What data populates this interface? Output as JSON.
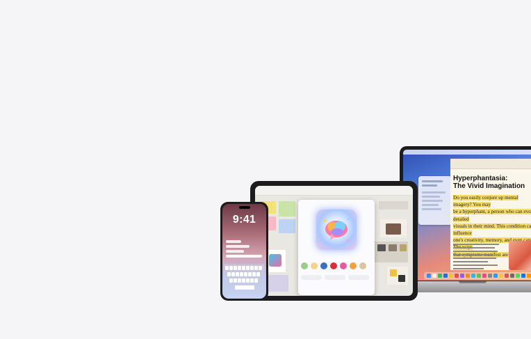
{
  "colors": {
    "page_background": "#f5f5f7",
    "device_frame": "#1c1c1e",
    "highlight": "#f5dc6a",
    "link_blue": "#3478f6"
  },
  "macbook": {
    "document": {
      "title_line1": "Hyperphantasia:",
      "title_line2": "The Vivid Imagination",
      "body_segment1": "Do you easily conjure up mental imagery? You may",
      "body_segment2": "be a hyperphant, a person who can evoke detailed",
      "body_segment3": "visuals in their mind. This condition can influence",
      "body_segment4": "one's creativity, memory, and even career. The ways",
      "body_segment5": "that symptoms manifest are astonishing."
    }
  },
  "iphone": {
    "time": "9:41"
  }
}
